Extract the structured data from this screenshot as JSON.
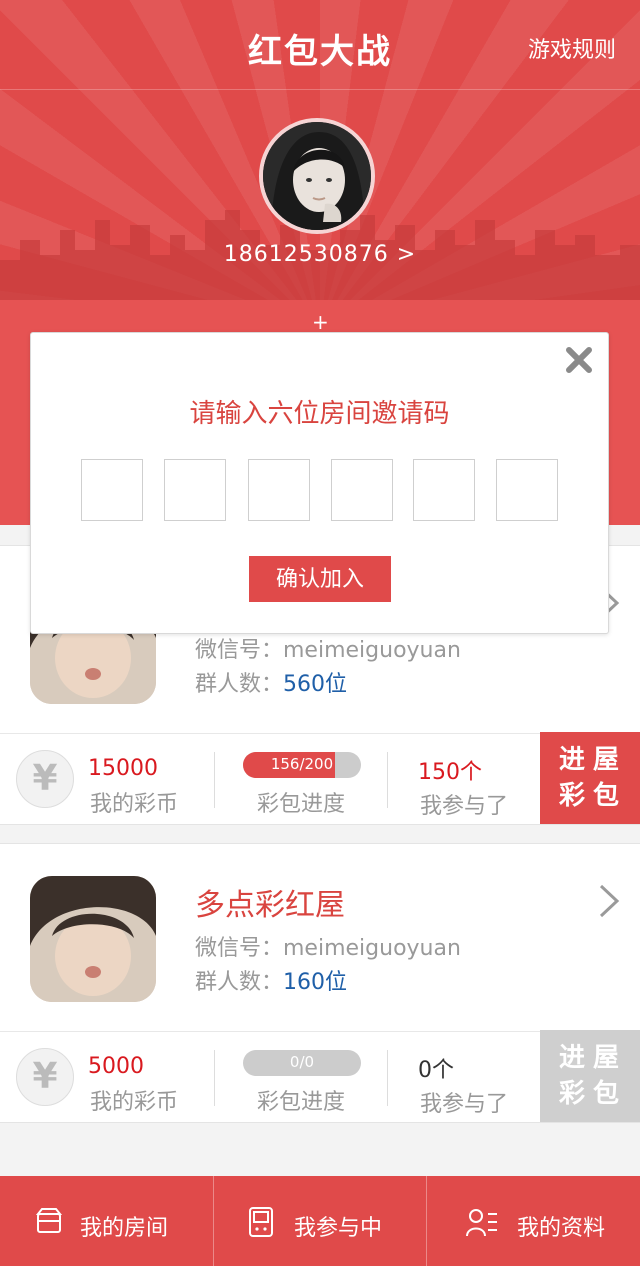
{
  "header": {
    "title": "红包大战",
    "rules_link": "游戏规则"
  },
  "profile": {
    "phone": "18612530876 >"
  },
  "hero": {
    "plus": "+"
  },
  "modal": {
    "title": "请输入六位房间邀请码",
    "code_box_count": 6,
    "confirm_label": "确认加入"
  },
  "rooms": [
    {
      "name": "",
      "wechat": "微信号：meimeiguoyuan",
      "members_label": "群人数：",
      "members_value": "560位",
      "coins_value": "15000",
      "coins_label": "我的彩币",
      "progress_text": "156/200",
      "progress_fraction": 0.78,
      "progress_label": "彩包进度",
      "joined_value": "150个",
      "joined_label": "我参与了",
      "enter_line1": "进屋",
      "enter_line2": "彩包",
      "enter_active": true
    },
    {
      "name": "多点彩红屋",
      "wechat": "微信号：meimeiguoyuan",
      "members_label": "群人数：",
      "members_value": "160位",
      "coins_value": "5000",
      "coins_label": "我的彩币",
      "progress_text": "0/0",
      "progress_fraction": 0,
      "progress_label": "彩包进度",
      "joined_value": "0个",
      "joined_label": "我参与了",
      "enter_line1": "进屋",
      "enter_line2": "彩包",
      "enter_active": false
    }
  ],
  "tabs": [
    {
      "label": "我的房间",
      "icon": "room-icon"
    },
    {
      "label": "我参与中",
      "icon": "gameboy-icon"
    },
    {
      "label": "我的资料",
      "icon": "profile-list-icon"
    }
  ],
  "colors": {
    "brand_red": "#e04a4a",
    "name_red": "#d9443f",
    "member_blue": "#1f5fa8",
    "disabled_gray": "#cfcfcf"
  },
  "icons": {
    "coin": "¥"
  }
}
